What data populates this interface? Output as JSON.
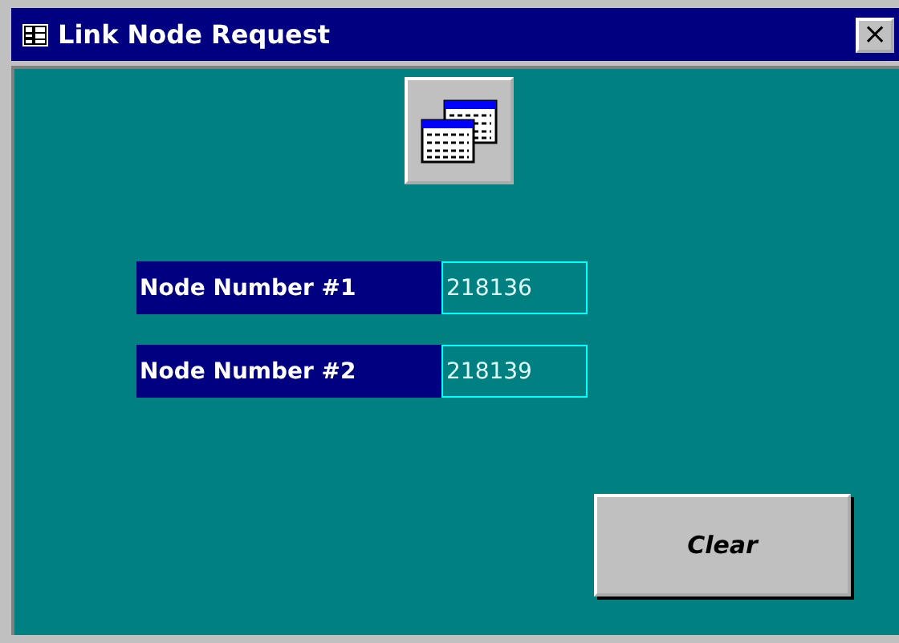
{
  "window": {
    "title": "Link Node Request",
    "close": "×"
  },
  "fields": [
    {
      "label": "Node Number #1",
      "value": "218136"
    },
    {
      "label": "Node Number #2",
      "value": "218139"
    }
  ],
  "buttons": [
    "Clear"
  ]
}
